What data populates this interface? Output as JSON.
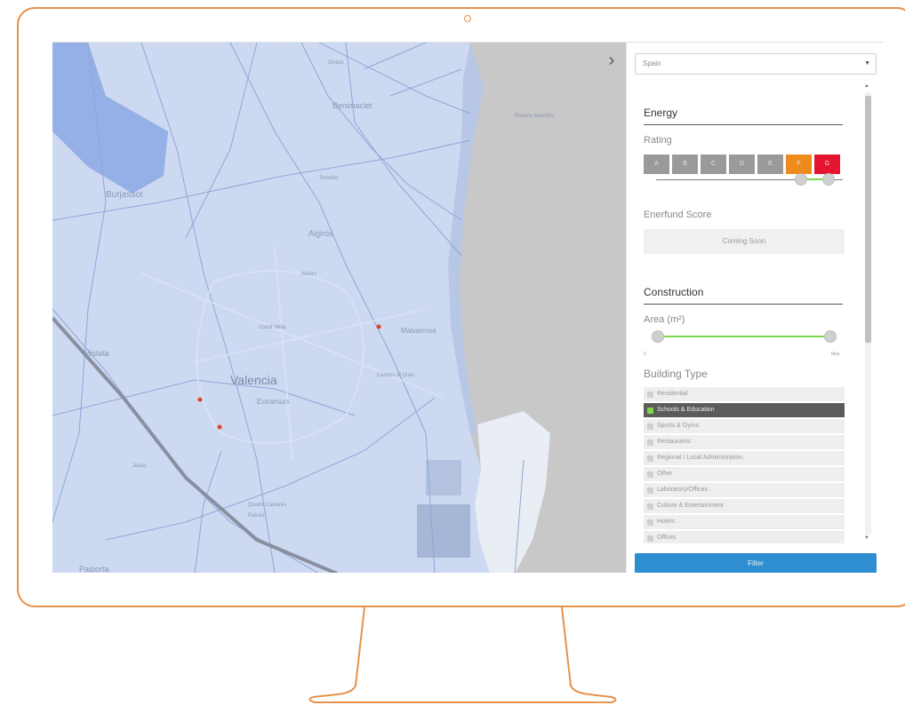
{
  "colors": {
    "frame": "#e8914a",
    "map_land": "#ccd9f1",
    "map_sea": "#c8c8c8",
    "rating_active_f": "#ef8a1c",
    "rating_active_g": "#e51530",
    "slider_fill": "#78d94a",
    "filter_button": "#2f8ed2",
    "active_checkbox": "#7fd348"
  },
  "map": {
    "toggle_icon": "chevron-right-icon",
    "labels": {
      "city": "Valencia",
      "district": "Extramurs",
      "north": "Benimaclet",
      "northwest": "Burjassot",
      "east": "Algirós",
      "west": "Mislata",
      "southwest": "Paiporta",
      "mid": "Albors",
      "port": "Malvarrosa",
      "small_1": "Ciutat Vella",
      "small_2": "Camins al Grau",
      "small_3": "Quatre Carreres",
      "small_4": "Jesús",
      "small_5": "Patraix",
      "small_6": "Poblats Marítims",
      "small_7": "Orriols",
      "small_8": "Torrefiel"
    }
  },
  "sidebar": {
    "country_select": {
      "value": "Spain"
    },
    "energy": {
      "title": "Energy",
      "rating_label": "Rating",
      "ratings": [
        "A",
        "B",
        "C",
        "D",
        "E",
        "F",
        "G"
      ],
      "selected_range": [
        "F",
        "G"
      ],
      "enerfund_label": "Enerfund Score",
      "coming_soon": "Coming Soon"
    },
    "construction": {
      "title": "Construction",
      "area_label": "Area (m²)",
      "area_min": "0",
      "area_max": "Max",
      "building_type_label": "Building Type",
      "building_types": [
        {
          "label": "Residential",
          "checked": false
        },
        {
          "label": "Schools & Education",
          "checked": true
        },
        {
          "label": "Sports & Gyms",
          "checked": false
        },
        {
          "label": "Restaurants",
          "checked": false
        },
        {
          "label": "Regional / Local Administration",
          "checked": false
        },
        {
          "label": "Other",
          "checked": false
        },
        {
          "label": "Laboratory/Offices",
          "checked": false
        },
        {
          "label": "Culture & Entertainment",
          "checked": false
        },
        {
          "label": "Hotels",
          "checked": false
        },
        {
          "label": "Offices",
          "checked": false
        }
      ]
    },
    "filter_button": "Filter"
  }
}
